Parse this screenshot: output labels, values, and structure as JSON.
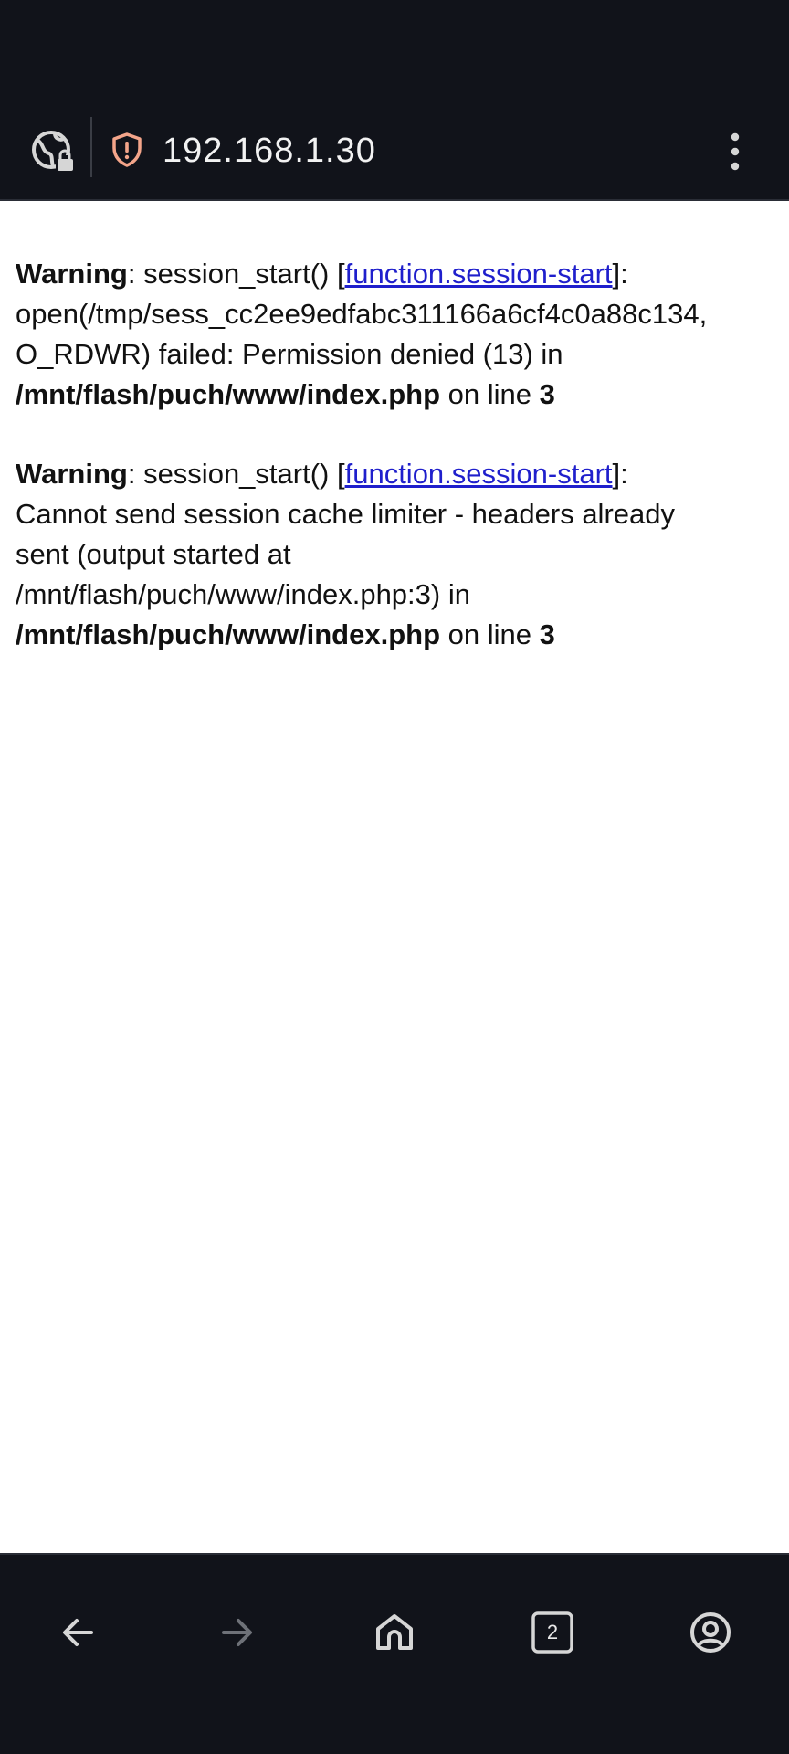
{
  "browser": {
    "url": "192.168.1.30",
    "tab_count": "2",
    "icons": {
      "site_info": "globe-lock-icon",
      "security": "shield-alert-icon",
      "menu": "more-vertical-icon",
      "back": "arrow-left-icon",
      "forward": "arrow-right-icon",
      "home": "home-icon",
      "tabs": "tabs-icon",
      "account": "account-circle-icon"
    },
    "colors": {
      "chrome": "#11131a",
      "shield": "#f4a58a",
      "link": "#1f1fcc"
    }
  },
  "page": {
    "warnings": [
      {
        "label": "Warning",
        "prefix": ": session_start() [",
        "link": "function.session-start",
        "message": "]:\nopen(/tmp/sess_cc2ee9edfabc311166a6cf4c0a88c134,\nO_RDWR) failed: Permission denied (13) in\n",
        "file": "/mnt/flash/puch/www/index.php",
        "on_line": " on line ",
        "line": "3"
      },
      {
        "label": "Warning",
        "prefix": ": session_start() [",
        "link": "function.session-start",
        "message": "]:\nCannot send session cache limiter - headers already\nsent (output started at\n/mnt/flash/puch/www/index.php:3) in\n",
        "file": "/mnt/flash/puch/www/index.php",
        "on_line": " on line ",
        "line": "3"
      }
    ]
  }
}
